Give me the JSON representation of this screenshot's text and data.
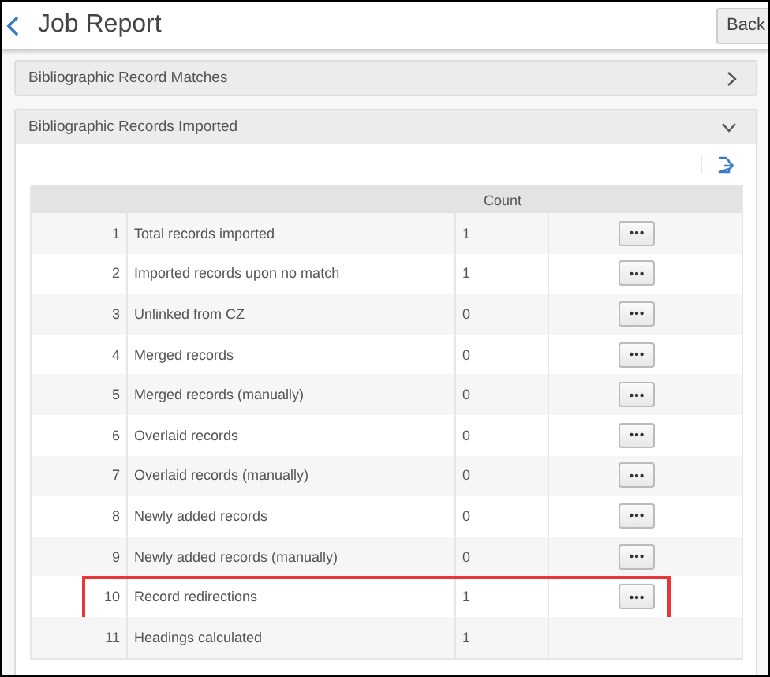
{
  "header": {
    "title": "Job Report",
    "back_button": "Back"
  },
  "sections": [
    {
      "title": "Bibliographic Record Matches",
      "expanded": false
    },
    {
      "title": "Bibliographic Records Imported",
      "expanded": true
    }
  ],
  "table": {
    "columns": [
      "",
      "",
      "Count",
      ""
    ],
    "rows": [
      {
        "number": "1",
        "label": "Total records imported",
        "count": "1",
        "has_actions": true,
        "highlighted": false
      },
      {
        "number": "2",
        "label": "Imported records upon no match",
        "count": "1",
        "has_actions": true,
        "highlighted": false
      },
      {
        "number": "3",
        "label": "Unlinked from CZ",
        "count": "0",
        "has_actions": true,
        "highlighted": false
      },
      {
        "number": "4",
        "label": "Merged records",
        "count": "0",
        "has_actions": true,
        "highlighted": false
      },
      {
        "number": "5",
        "label": "Merged records (manually)",
        "count": "0",
        "has_actions": true,
        "highlighted": false
      },
      {
        "number": "6",
        "label": "Overlaid records",
        "count": "0",
        "has_actions": true,
        "highlighted": false
      },
      {
        "number": "7",
        "label": "Overlaid records (manually)",
        "count": "0",
        "has_actions": true,
        "highlighted": false
      },
      {
        "number": "8",
        "label": "Newly added records",
        "count": "0",
        "has_actions": true,
        "highlighted": false
      },
      {
        "number": "9",
        "label": "Newly added records (manually)",
        "count": "0",
        "has_actions": true,
        "highlighted": false
      },
      {
        "number": "10",
        "label": "Record redirections",
        "count": "1",
        "has_actions": true,
        "highlighted": true
      },
      {
        "number": "11",
        "label": "Headings calculated",
        "count": "1",
        "has_actions": false,
        "highlighted": false
      }
    ]
  }
}
